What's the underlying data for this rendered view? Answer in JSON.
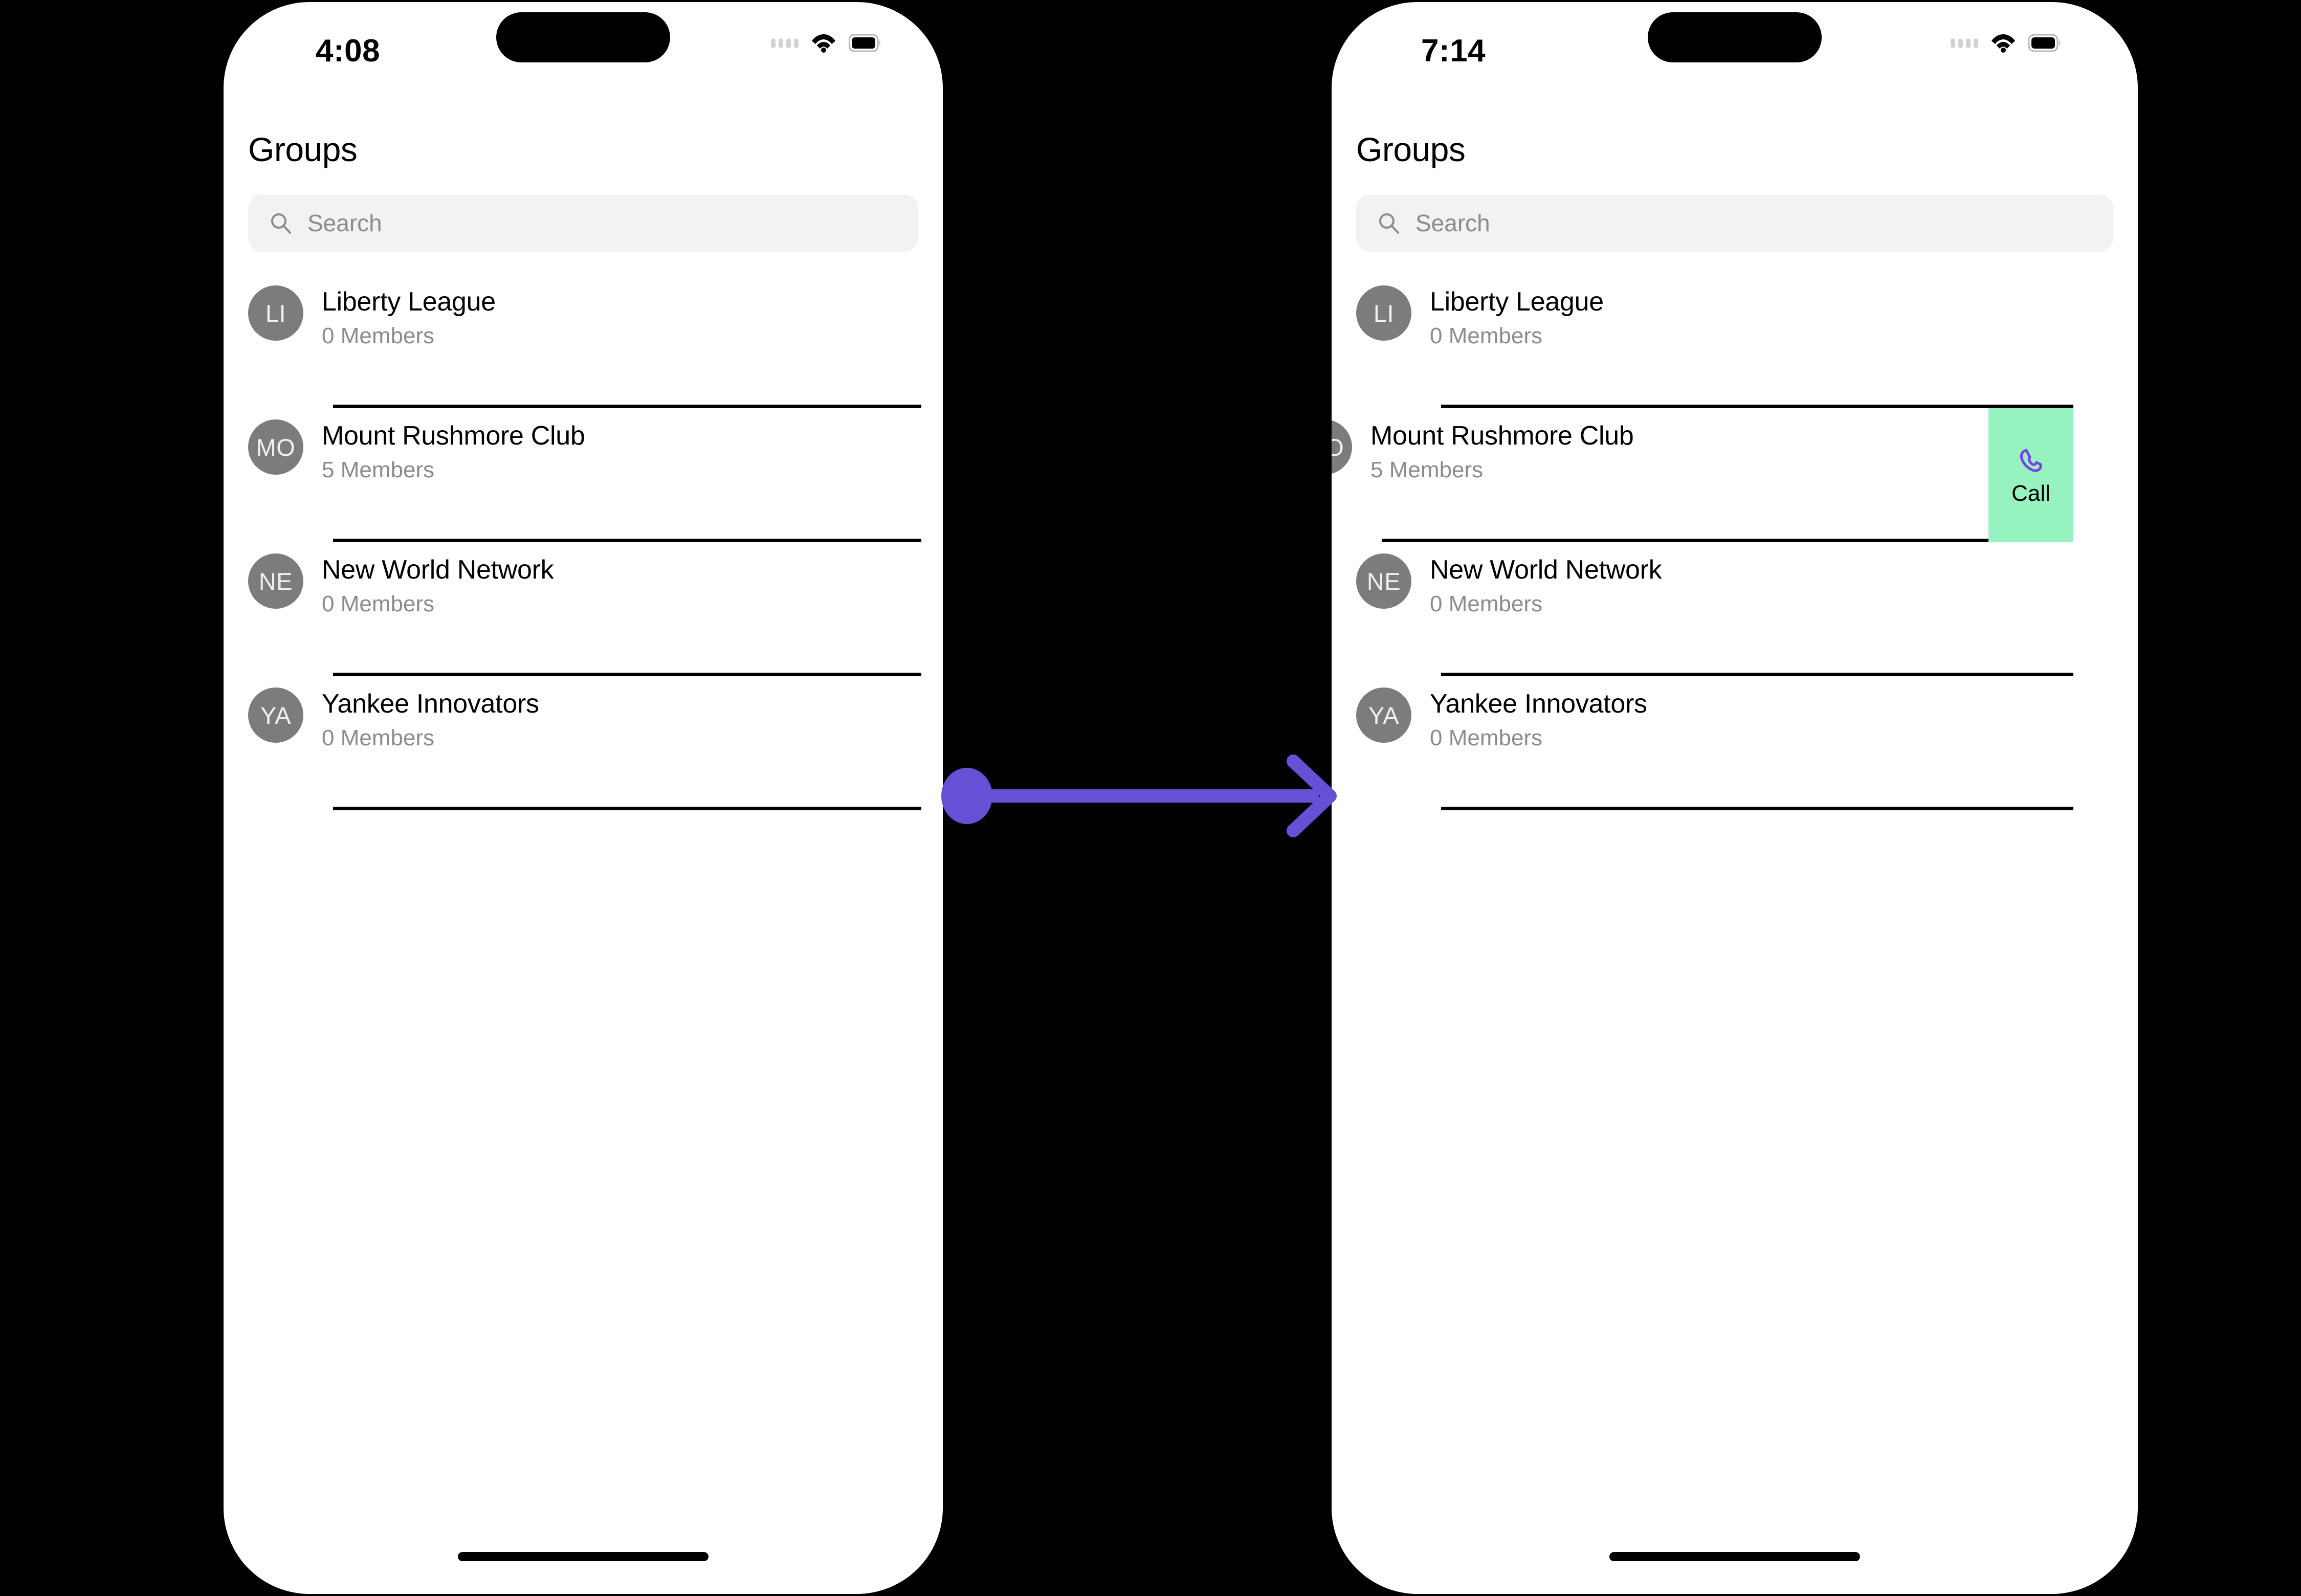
{
  "colors": {
    "background": "#000000",
    "screen": "#ffffff",
    "avatar": "#7c7c7c",
    "search_field": "#f2f2f3",
    "secondary_text": "#8b8b8f",
    "call_action_background": "#96f2bf",
    "call_icon": "#7b3fe4",
    "arrow": "#6650d5"
  },
  "screens": [
    {
      "id": "before",
      "status_bar": {
        "time": "4:08",
        "icons": [
          "cellular-dots-icon",
          "wifi-icon",
          "battery-icon"
        ]
      },
      "header": {
        "title": "Groups"
      },
      "search": {
        "placeholder": "Search",
        "value": "",
        "icon": "search-icon"
      },
      "rows": [
        {
          "initials": "LI",
          "title": "Liberty League",
          "subtitle": "0 Members",
          "swiped": false
        },
        {
          "initials": "MO",
          "title": "Mount Rushmore Club",
          "subtitle": "5 Members",
          "swiped": false
        },
        {
          "initials": "NE",
          "title": "New World Network",
          "subtitle": "0 Members",
          "swiped": false
        },
        {
          "initials": "YA",
          "title": "Yankee Innovators",
          "subtitle": "0 Members",
          "swiped": false
        }
      ]
    },
    {
      "id": "after",
      "status_bar": {
        "time": "7:14",
        "icons": [
          "cellular-dots-icon",
          "wifi-icon",
          "battery-icon"
        ]
      },
      "header": {
        "title": "Groups"
      },
      "search": {
        "placeholder": "Search",
        "value": "",
        "icon": "search-icon"
      },
      "rows": [
        {
          "initials": "LI",
          "title": "Liberty League",
          "subtitle": "0 Members",
          "swiped": false
        },
        {
          "initials": "MO",
          "title": "Mount Rushmore Club",
          "subtitle": "5 Members",
          "swiped": true,
          "swipe_action": {
            "label": "Call",
            "icon": "phone-handset-icon"
          }
        },
        {
          "initials": "NE",
          "title": "New World Network",
          "subtitle": "0 Members",
          "swiped": false
        },
        {
          "initials": "YA",
          "title": "Yankee Innovators",
          "subtitle": "0 Members",
          "swiped": false
        }
      ]
    }
  ],
  "annotation": {
    "type": "swipe-arrow",
    "direction": "left-to-right"
  }
}
